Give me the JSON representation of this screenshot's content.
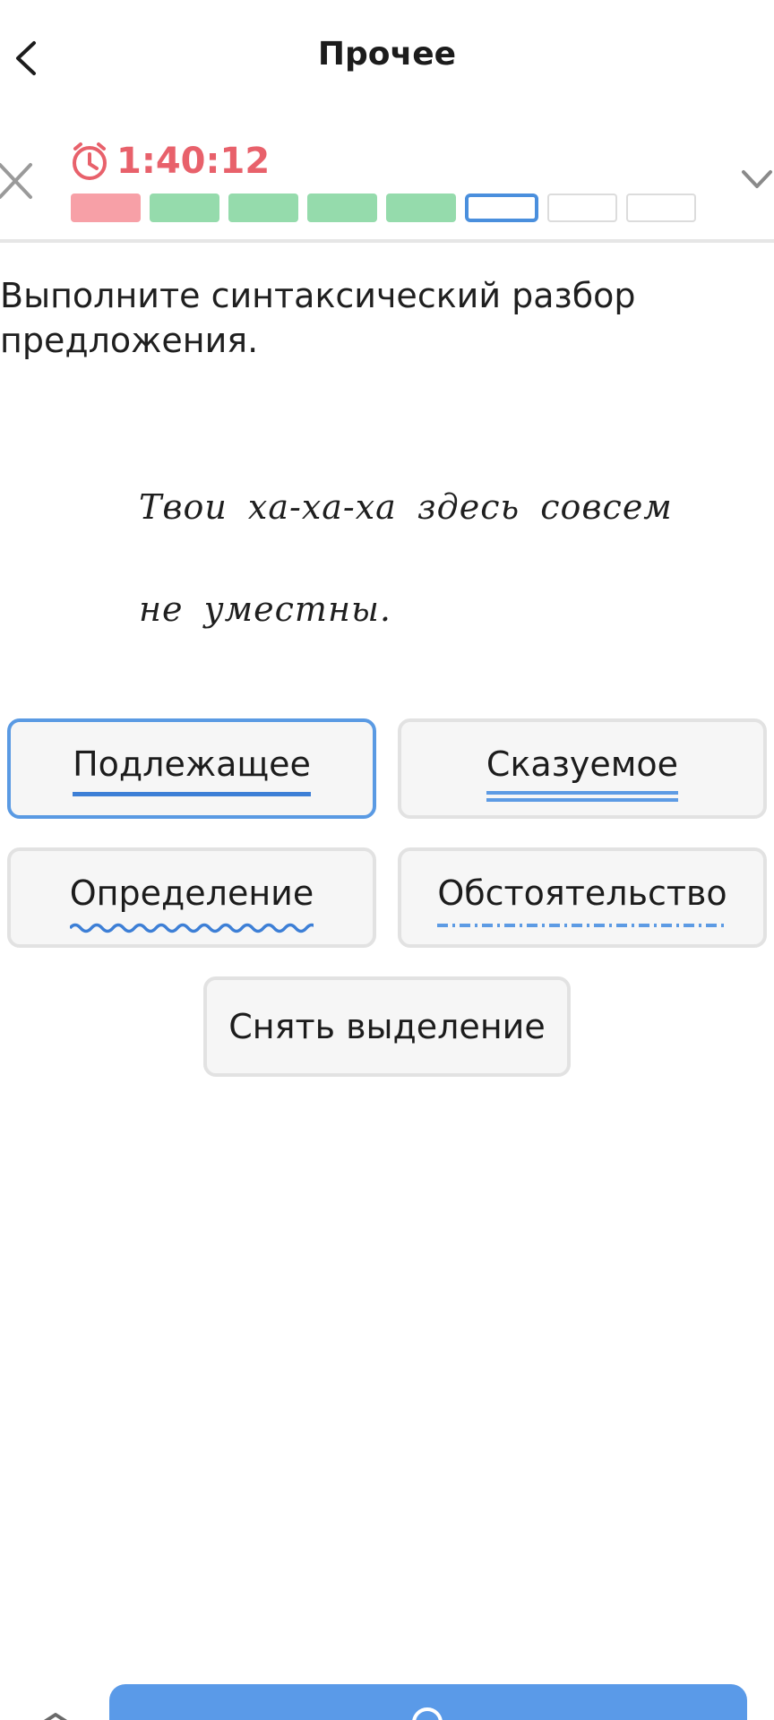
{
  "header": {
    "title": "Прочее",
    "back_icon": "chevron-left-icon"
  },
  "progress": {
    "timer": "1:40:12",
    "timer_color": "#e8616b",
    "close_icon": "close-icon",
    "expand_icon": "chevron-down-icon",
    "segments": [
      "incorrect",
      "correct",
      "correct",
      "correct",
      "correct",
      "current",
      "empty",
      "empty"
    ],
    "colors": {
      "incorrect": "#f7a0a7",
      "correct": "#95dbac",
      "current_border": "#4a8fdd",
      "accent": "#5a9ae8"
    }
  },
  "task": {
    "instruction": "Выполните синтаксический разбор предложения.",
    "sentence_line1": "Твои ха-ха-ха здесь совсем",
    "sentence_line2": "не уместны."
  },
  "options": {
    "subject": "Подлежащее",
    "predicate": "Сказуемое",
    "attribute": "Определение",
    "adverbial": "Обстоятельство",
    "clear": "Снять выделение",
    "selected": "subject"
  }
}
